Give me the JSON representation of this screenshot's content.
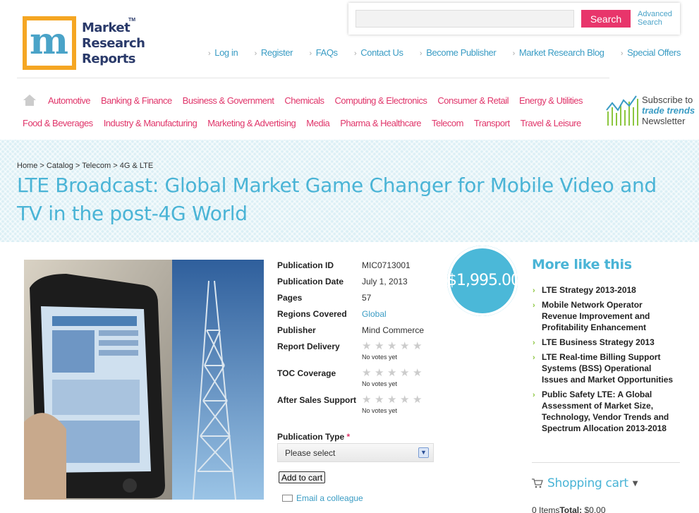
{
  "logo": {
    "line1": "Market",
    "line2": "Research",
    "line3": "Reports",
    "tm": "TM"
  },
  "search": {
    "placeholder": "",
    "button": "Search",
    "advanced": "Advanced Search"
  },
  "top_links": [
    "Log in",
    "Register",
    "FAQs",
    "Contact Us",
    "Become Publisher",
    "Market Research Blog",
    "Special Offers"
  ],
  "categories_row1": [
    "Automotive",
    "Banking & Finance",
    "Business & Government",
    "Chemicals",
    "Computing & Electronics",
    "Consumer & Retail",
    "Energy & Utilities"
  ],
  "categories_row2": [
    "Food & Beverages",
    "Industry & Manufacturing",
    "Marketing & Advertising",
    "Media",
    "Pharma & Healthcare",
    "Telecom",
    "Transport",
    "Travel & Leisure"
  ],
  "newsletter": {
    "line1": "Subscribe to",
    "line2": "trade trends",
    "line3": "Newsletter"
  },
  "breadcrumb": {
    "home": "Home",
    "catalog": "Catalog",
    "telecom": "Telecom",
    "current": "4G & LTE",
    "sep": ">"
  },
  "title": "LTE Broadcast: Global Market Game Changer for Mobile Video and TV in the post-4G World",
  "details": {
    "pub_id_label": "Publication ID",
    "pub_id": "MIC0713001",
    "pub_date_label": "Publication Date",
    "pub_date": "July 1, 2013",
    "pages_label": "Pages",
    "pages": "57",
    "regions_label": "Regions Covered",
    "regions": "Global",
    "publisher_label": "Publisher",
    "publisher": "Mind Commerce",
    "delivery_label": "Report Delivery",
    "toc_label": "TOC Coverage",
    "support_label": "After Sales Support",
    "no_votes": "No votes yet",
    "star_glyph": "★"
  },
  "pub_type": {
    "label": "Publication Type",
    "required": "*",
    "selected": "Please select"
  },
  "add_to_cart": "Add to cart",
  "email_colleague": "Email a colleague",
  "price": "$1,995.00",
  "more_like_this": {
    "title": "More like this",
    "items": [
      "LTE Strategy 2013-2018",
      "Mobile Network Operator Revenue Improvement and Profitability Enhancement",
      "LTE Business Strategy 2013",
      "LTE Real-time Billing Support Systems (BSS) Operational Issues and Market Opportunities",
      "Public Safety LTE: A Global Assessment of Market Size, Technology, Vendor Trends and Spectrum Allocation 2013-2018"
    ]
  },
  "cart": {
    "title": "Shopping cart",
    "items": "0 Items",
    "total_label": "Total:",
    "total": "$0.00"
  },
  "colors": {
    "accent_blue": "#4ab4d6",
    "link_pink": "#e0356a",
    "search_btn": "#e8356b",
    "logo_orange": "#f5a623",
    "green": "#8cc63f"
  }
}
